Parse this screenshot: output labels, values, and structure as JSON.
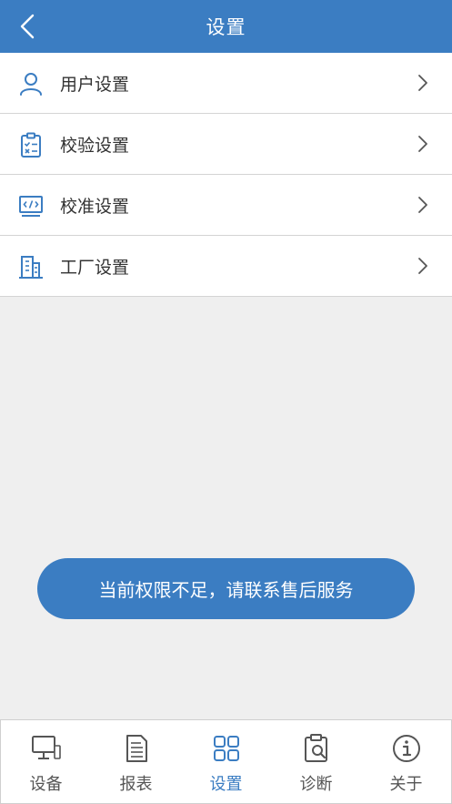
{
  "header": {
    "title": "设置",
    "back_icon": "chevron-left-icon"
  },
  "menu": {
    "items": [
      {
        "label": "用户设置",
        "icon": "user-icon"
      },
      {
        "label": "校验设置",
        "icon": "clipboard-checklist-icon"
      },
      {
        "label": "校准设置",
        "icon": "code-monitor-icon"
      },
      {
        "label": "工厂设置",
        "icon": "factory-building-icon"
      }
    ]
  },
  "toast": {
    "message": "当前权限不足，请联系售后服务"
  },
  "tabbar": {
    "active_index": 2,
    "tabs": [
      {
        "label": "设备",
        "icon": "device-monitor-icon"
      },
      {
        "label": "报表",
        "icon": "report-document-icon"
      },
      {
        "label": "设置",
        "icon": "grid-settings-icon"
      },
      {
        "label": "诊断",
        "icon": "diagnosis-clipboard-icon"
      },
      {
        "label": "关于",
        "icon": "info-icon"
      }
    ]
  },
  "colors": {
    "accent": "#3b7dc2",
    "background": "#efefef",
    "divider": "#d4d4d4"
  }
}
